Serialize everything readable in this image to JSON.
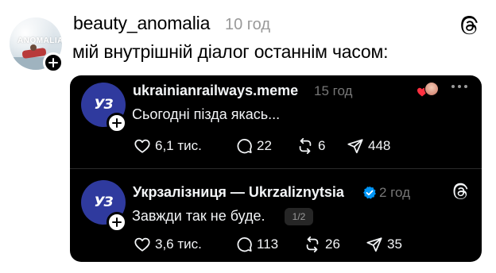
{
  "outer_post": {
    "username": "beauty_anomalia",
    "time": "10 год",
    "text": "мій внутрішній діалог останнім часом:",
    "avatar_text": "ANOMALIA"
  },
  "quoted_posts": [
    {
      "username": "ukrainianrailways.meme",
      "time": "15 год",
      "text": "Сьогодні пізда якась...",
      "avatar_logo": "УЗ",
      "likes": "6,1 тис.",
      "comments": "22",
      "reposts": "6",
      "shares": "448"
    },
    {
      "username": "Укрзалізниця — Ukrzaliznytsia",
      "time": "2 год",
      "text": "Завжди так не буде.",
      "page_indicator": "1/2",
      "avatar_logo": "УЗ",
      "likes": "3,6 тис.",
      "comments": "113",
      "reposts": "26",
      "shares": "35",
      "verified": true
    }
  ],
  "colors": {
    "card_bg": "#000000",
    "avatar_blue": "#2f3a9e",
    "verified_blue": "#0095f6",
    "muted_text": "#777777",
    "heart_red": "#ff3040"
  },
  "icons": [
    "threads-icon",
    "plus-icon",
    "heart-icon",
    "comment-icon",
    "repost-icon",
    "share-icon",
    "verified-icon",
    "more-icon"
  ]
}
